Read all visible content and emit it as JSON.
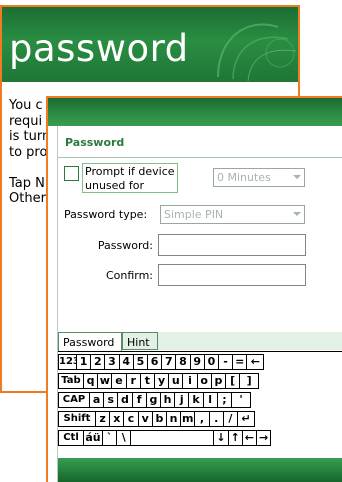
{
  "back_screen": {
    "title": "password",
    "text": "You c\nrequi\nis turn\nto pro\n\nTap N\nOther"
  },
  "dialog": {
    "title": "Password",
    "prompt_checkbox": {
      "label": "Prompt if device\nunused for",
      "checked": false
    },
    "timeout_select": {
      "value": "0 Minutes"
    },
    "password_type": {
      "label": "Password type:",
      "value": "Simple PIN"
    },
    "password_field": {
      "label": "Password:",
      "value": ""
    },
    "confirm_field": {
      "label": "Confirm:",
      "value": ""
    },
    "tabs": [
      {
        "label": "Password",
        "active": true
      },
      {
        "label": "Hint",
        "active": false
      }
    ]
  },
  "keyboard": {
    "rows": [
      [
        "123",
        "1",
        "2",
        "3",
        "4",
        "5",
        "6",
        "7",
        "8",
        "9",
        "0",
        "-",
        "=",
        "←"
      ],
      [
        "Tab",
        "q",
        "w",
        "e",
        "r",
        "t",
        "y",
        "u",
        "i",
        "o",
        "p",
        "[",
        "]"
      ],
      [
        "CAP",
        "a",
        "s",
        "d",
        "f",
        "g",
        "h",
        "j",
        "k",
        "l",
        ";",
        "'"
      ],
      [
        "Shift",
        "z",
        "x",
        "c",
        "v",
        "b",
        "n",
        "m",
        ",",
        ".",
        "/",
        "↵"
      ],
      [
        "Ctl",
        "áü",
        "`",
        "\\",
        "",
        "↓",
        "↑",
        "←",
        "→"
      ]
    ]
  },
  "colors": {
    "accent_orange": "#ee7c22",
    "header_green": "#2a8d42",
    "title_green": "#2b7a3d",
    "hint_tab_bg": "#e3f0e5"
  }
}
